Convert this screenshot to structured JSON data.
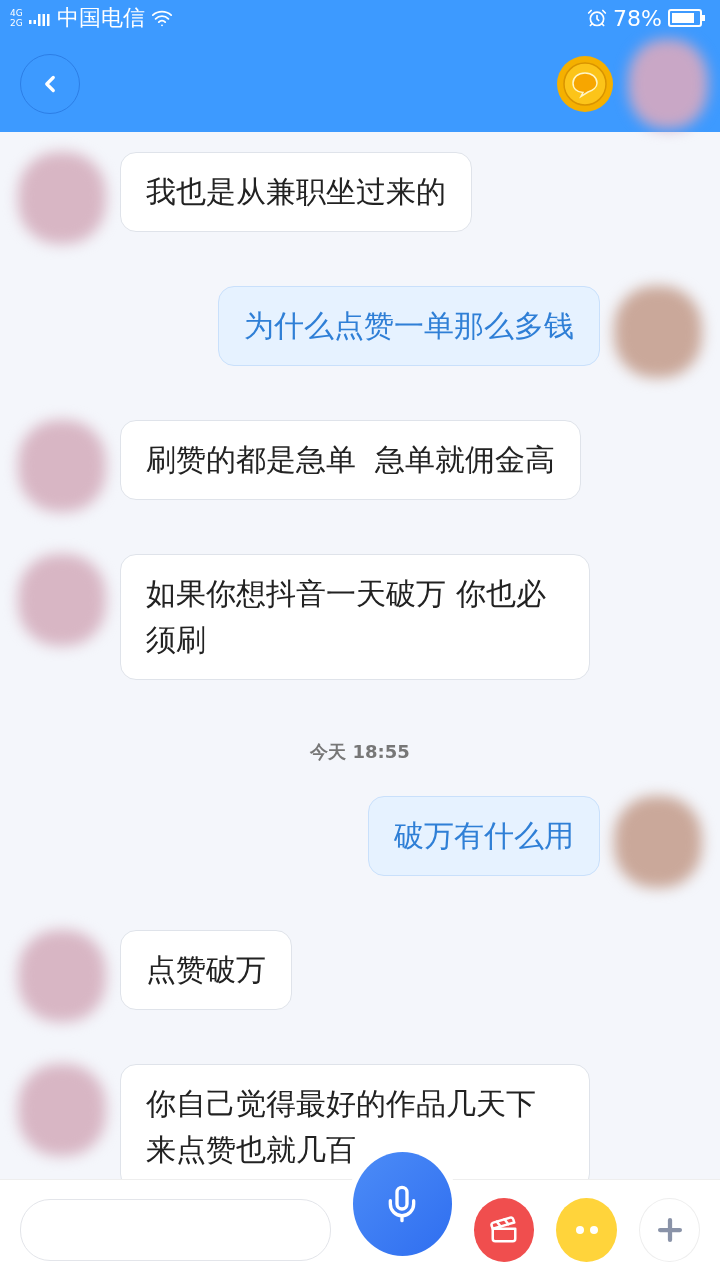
{
  "status_bar": {
    "network_top": "4G",
    "network_bottom": "2G",
    "carrier": "中国电信",
    "battery": "78%"
  },
  "messages": [
    {
      "kind": "left",
      "text": "我也是从兼职坐过来的"
    },
    {
      "kind": "right",
      "text": "为什么点赞一单那么多钱"
    },
    {
      "kind": "left",
      "text": "刷赞的都是急单  急单就佣金高"
    },
    {
      "kind": "left",
      "text": "如果你想抖音一天破万 你也必须刷"
    },
    {
      "kind": "time",
      "text": "今天 18:55"
    },
    {
      "kind": "right",
      "text": "破万有什么用"
    },
    {
      "kind": "left",
      "text": "点赞破万"
    },
    {
      "kind": "left",
      "text": "你自己觉得最好的作品几天下来点赞也就几百"
    }
  ]
}
